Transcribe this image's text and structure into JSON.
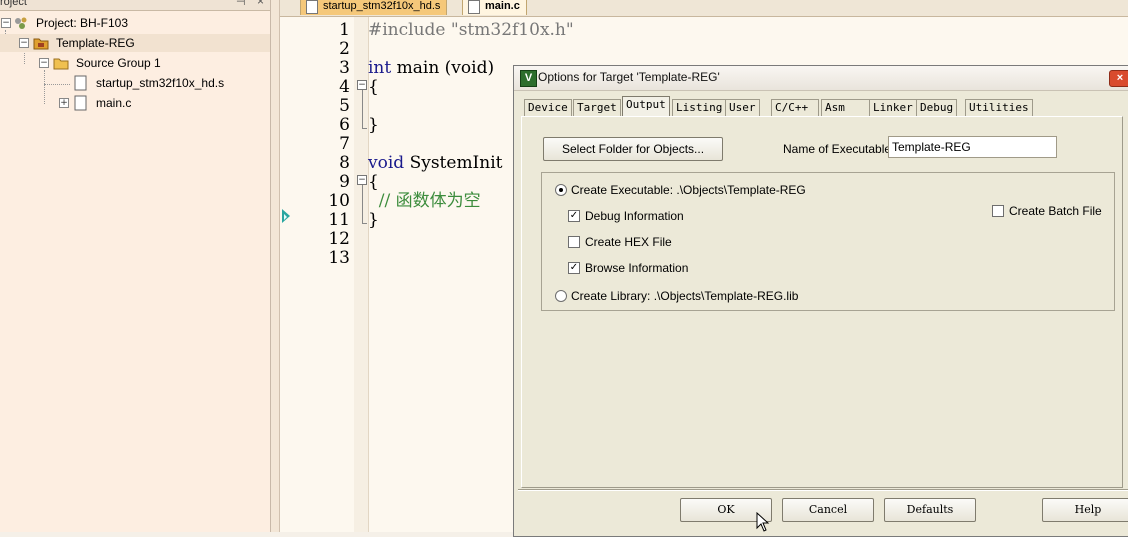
{
  "project_panel": {
    "header_title": "roject",
    "pin_glyph": "⊣",
    "close_glyph": "×",
    "items": [
      {
        "label": "Project: BH-F103",
        "icon": "project-icon"
      },
      {
        "label": "Template-REG",
        "icon": "target-folder-icon"
      },
      {
        "label": "Source Group 1",
        "icon": "folder-icon"
      },
      {
        "label": "startup_stm32f10x_hd.s",
        "icon": "file-icon"
      },
      {
        "label": "main.c",
        "icon": "file-icon"
      }
    ]
  },
  "editor": {
    "tabs": [
      {
        "label": "startup_stm32f10x_hd.s",
        "active": false
      },
      {
        "label": "main.c",
        "active": true
      }
    ],
    "line_numbers": [
      "1",
      "2",
      "3",
      "4",
      "5",
      "6",
      "7",
      "8",
      "9",
      "10",
      "11",
      "12",
      "13"
    ],
    "lines": {
      "l1_directive": "#include",
      "l1_string": " \"stm32f10x.h\"",
      "l3_type": "int",
      "l3_rest": " main (void)",
      "l4": "{",
      "l6": "}",
      "l8_type": "void",
      "l8_rest": " SystemInit",
      "l9": "{",
      "l10_comment": "  // 函数体为空",
      "l11": "}"
    }
  },
  "dialog": {
    "title": "Options for Target 'Template-REG'",
    "logo": "V",
    "close_label": "×",
    "tabs": [
      "Device",
      "Target",
      "Output",
      "Listing",
      "User",
      "C/C++",
      "Asm",
      "Linker",
      "Debug",
      "Utilities"
    ],
    "active_tab": "Output",
    "select_folder_label": "Select Folder for Objects...",
    "name_of_executable_label": "Name of Executable:",
    "name_of_executable_value": "Template-REG",
    "create_executable_label": "Create Executable:  .\\Objects\\Template-REG",
    "debug_information_label": "Debug Information",
    "create_hex_label": "Create HEX File",
    "browse_information_label": "Browse Information",
    "create_library_label": "Create Library:  .\\Objects\\Template-REG.lib",
    "create_batch_label": "Create Batch File",
    "check_glyph": "✓",
    "states": {
      "create_executable": true,
      "debug_information": true,
      "create_hex": false,
      "browse_information": true,
      "create_library": false,
      "create_batch": false
    },
    "buttons": {
      "ok": "OK",
      "cancel": "Cancel",
      "defaults": "Defaults",
      "help": "Help"
    }
  }
}
